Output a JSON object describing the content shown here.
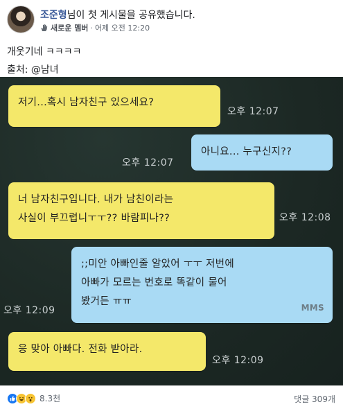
{
  "header": {
    "author_name": "조준형",
    "action_text": "님이 첫 게시물을 공유했습니다.",
    "badge": "새로운 멤버",
    "separator": "·",
    "timestamp": "어제 오전 12:20"
  },
  "post": {
    "lines": [
      "개웃기네 ㅋㅋㅋㅋ",
      "출처: @남녀"
    ]
  },
  "chat": {
    "messages": [
      {
        "side": "left",
        "color": "yellow",
        "lines": [
          "저기...혹시 남자친구 있으세요?"
        ],
        "time": "오후 12:07"
      },
      {
        "side": "right",
        "color": "blue",
        "lines": [
          "아니요... 누구신지??"
        ],
        "time": "오후 12:07"
      },
      {
        "side": "left",
        "color": "yellow",
        "lines": [
          "너 남자친구입니다. 내가 남친이라는",
          "사실이 부끄럽니ㅜㅜ?? 바람피나??"
        ],
        "time": "오후 12:08"
      },
      {
        "side": "right",
        "color": "blue",
        "lines": [
          ";;미안 아빠인줄 알았어 ㅜㅜ 저번에",
          "아빠가 모르는 번호로 똑같이 물어",
          "봤거든 ㅠㅠ"
        ],
        "time": "오후 12:09",
        "tag": "MMS"
      },
      {
        "side": "left",
        "color": "yellow",
        "lines": [
          "응 맞아 아빠다. 전화 받아라."
        ],
        "time": "오후 12:09"
      }
    ]
  },
  "footer": {
    "reaction_icons": [
      "like-icon",
      "haha-icon",
      "wow-icon"
    ],
    "reaction_count": "8.3천",
    "comment_count": "댓글 309개"
  }
}
